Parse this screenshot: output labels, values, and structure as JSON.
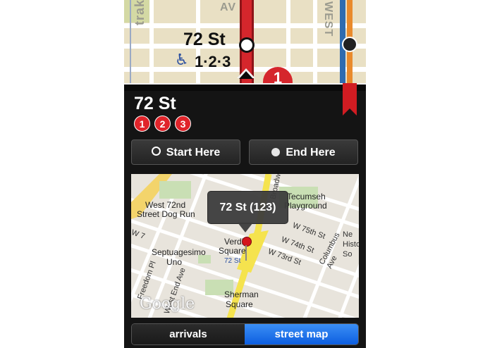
{
  "subway_map": {
    "street_labels": [
      "trak",
      "AV",
      "WEST"
    ],
    "station_name": "72 St",
    "routes_text": "1·2·3",
    "route_badge": "1",
    "wheelchair_icon": "♿"
  },
  "station": {
    "title": "72 St",
    "routes": [
      "1",
      "2",
      "3"
    ]
  },
  "actions": {
    "start_label": "Start Here",
    "end_label": "End Here"
  },
  "street_map": {
    "callout": "72 St (123)",
    "logo": "Google",
    "labels": {
      "west72_1": "West 72nd",
      "west72_2": "Street Dog Run",
      "tecumseh_1": "Tecumseh",
      "tecumseh_2": "Playground",
      "w75": "W 75th St",
      "w74": "W 74th St",
      "w73": "W 73rd St",
      "columbus": "Columbus Ave",
      "septuagesimo_1": "Septuagesimo",
      "septuagesimo_2": "Uno",
      "verdi_1": "Verdi",
      "verdi_2": "Square",
      "station_small": "72 St",
      "sherman_1": "Sherman",
      "sherman_2": "Square",
      "freedom_pl": "Freedom Pl",
      "west_end": "West End Ave",
      "w7": "W 7",
      "broadway": "Broadway",
      "ne_1": "Ne",
      "ne_2": "Histo",
      "ne_3": "So"
    }
  },
  "tabs": {
    "arrivals": "arrivals",
    "street_map": "street map",
    "active": "street map"
  },
  "colors": {
    "route_red": "#e0242a",
    "tab_active": "#1a6ff0",
    "bookmark": "#d11c22"
  }
}
